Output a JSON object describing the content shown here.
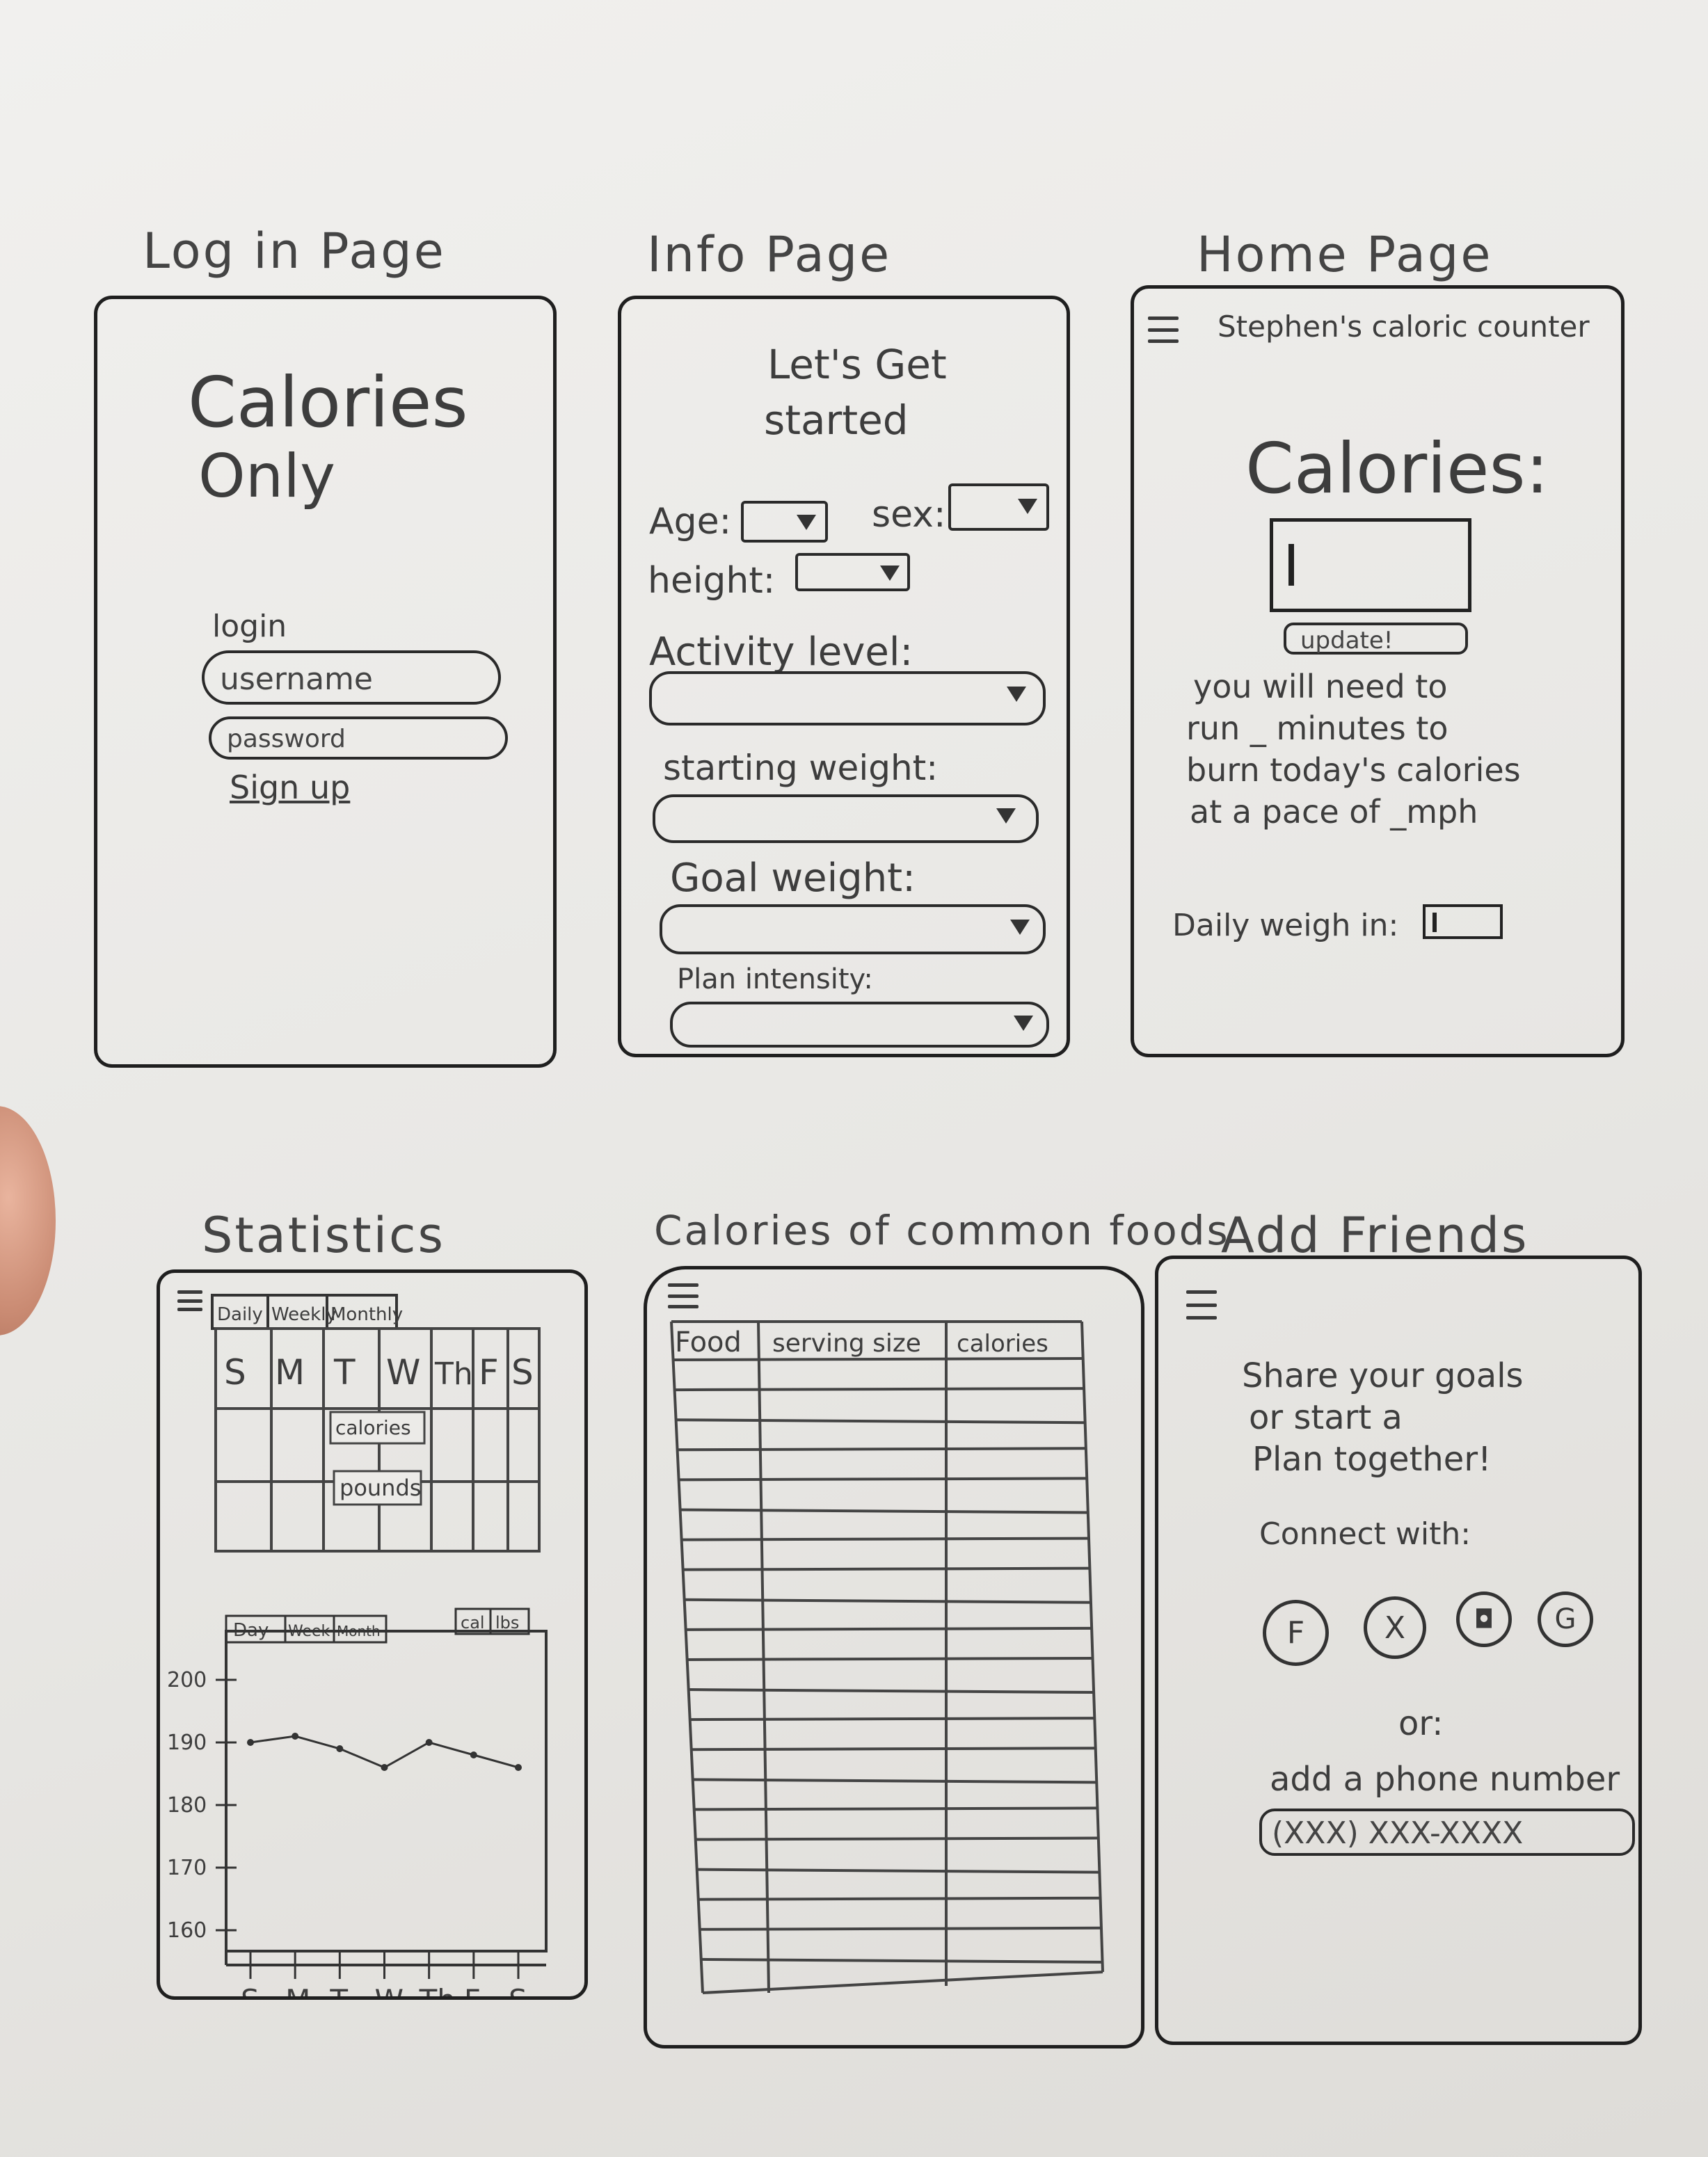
{
  "pages": {
    "login": {
      "title": "Log in Page",
      "app_name_line1": "Calories",
      "app_name_line2": "Only",
      "login_label": "login",
      "username_placeholder": "username",
      "password_placeholder": "password",
      "signup_link": "Sign up"
    },
    "info": {
      "title": "Info Page",
      "heading_line1": "Let's Get",
      "heading_line2": "started",
      "age_label": "Age:",
      "sex_label": "sex:",
      "height_label": "height:",
      "activity_label": "Activity level:",
      "starting_weight_label": "starting weight:",
      "goal_weight_label": "Goal weight:",
      "plan_intensity_label": "Plan intensity:"
    },
    "home": {
      "title": "Home Page",
      "header": "Stephen's caloric counter",
      "calories_label": "Calories:",
      "update_button": "update!",
      "message_line1": "you will need to",
      "message_line2": "run _ minutes to",
      "message_line3": "burn today's calories",
      "message_line4": "at a pace of _mph",
      "daily_weigh_in_label": "Daily weigh in:"
    },
    "statistics": {
      "title": "Statistics",
      "calendar_tabs": [
        "Daily",
        "Weekly",
        "Monthly"
      ],
      "days": [
        "S",
        "M",
        "T",
        "W",
        "Th",
        "F",
        "S"
      ],
      "cell_calories": "calories",
      "cell_pounds": "pounds",
      "chart_tabs": [
        "Day",
        "Week",
        "Month"
      ],
      "unit_toggles": [
        "cal",
        "lbs"
      ]
    },
    "foods": {
      "title": "Calories of common foods",
      "columns": [
        "Food",
        "serving size",
        "calories"
      ]
    },
    "friends": {
      "title": "Add Friends",
      "message_line1": "Share your goals",
      "message_line2": "or start a",
      "message_line3": "Plan together!",
      "connect_label": "Connect with:",
      "social_buttons": [
        "F",
        "X",
        "◘",
        "G"
      ],
      "or_label": "or:",
      "phone_label": "add a phone number",
      "phone_placeholder": "(XXX) XXX-XXXX"
    }
  },
  "chart_data": {
    "type": "line",
    "title": "",
    "x": [
      "S",
      "M",
      "T",
      "W",
      "Th",
      "F",
      "S"
    ],
    "y_ticks": [
      200,
      190,
      180,
      170,
      160
    ],
    "ylim": [
      160,
      200
    ],
    "series": [
      {
        "values": [
          190,
          191,
          189,
          186,
          190,
          188,
          186
        ]
      }
    ]
  }
}
